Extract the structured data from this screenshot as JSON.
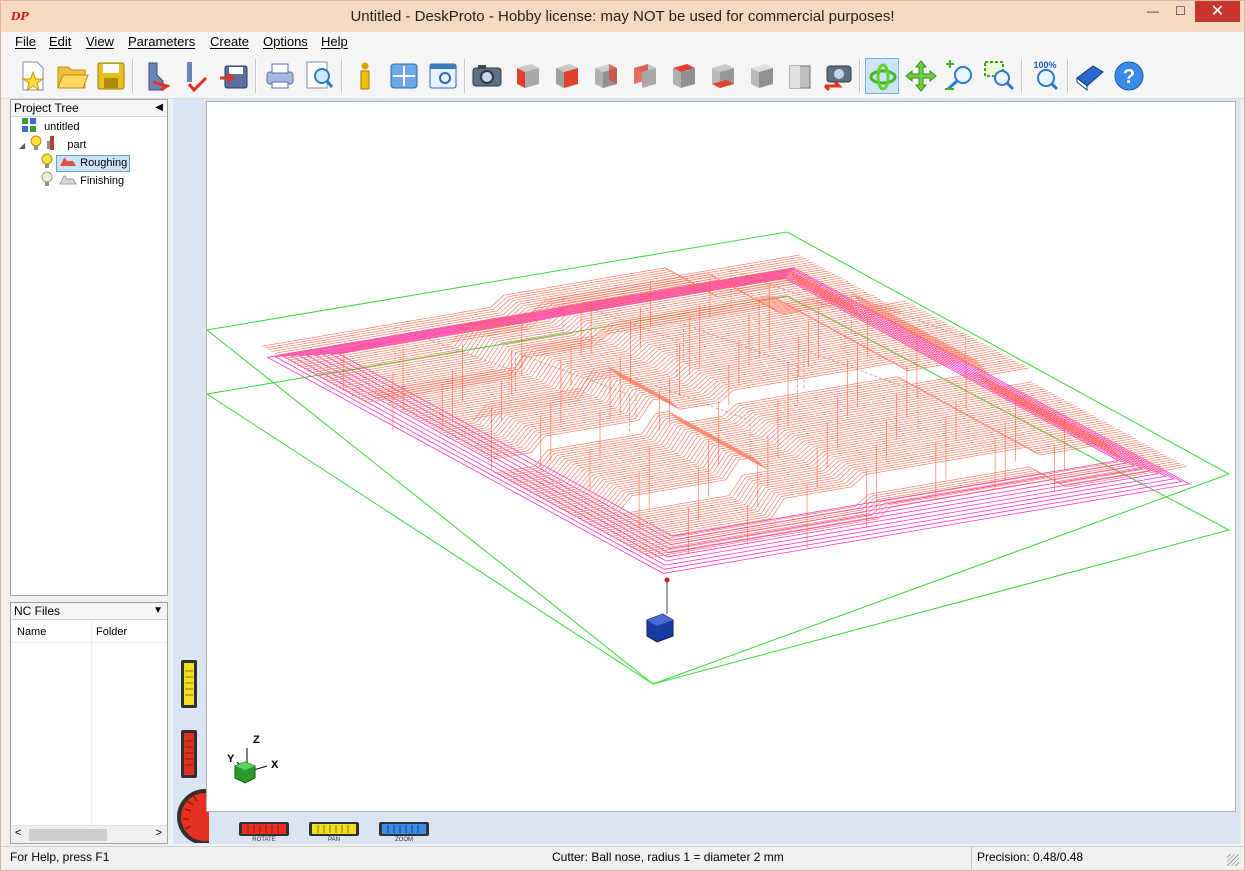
{
  "window": {
    "logo": "DP",
    "title": "Untitled - DeskProto - Hobby license: may NOT be used for commercial purposes!",
    "minimize": "—",
    "maximize": "☐",
    "close": "✕"
  },
  "menu": [
    "File",
    "Edit",
    "View",
    "Parameters",
    "Create",
    "Options",
    "Help"
  ],
  "toolbar": {
    "icons": [
      "new-project",
      "open-project",
      "save-project",
      "load-part",
      "load-vector",
      "save-as",
      "print",
      "print-preview",
      "info",
      "layout",
      "preview",
      "snapshot",
      "view-front",
      "view-right",
      "view-back",
      "view-left",
      "view-top",
      "view-bottom",
      "view-iso",
      "view-reset",
      "camera-restore",
      "rotate-mode",
      "pan-mode",
      "zoom-mode",
      "zoom-window",
      "zoom-100",
      "manual",
      "help"
    ],
    "zoom100_label": "100%"
  },
  "project_tree": {
    "title": "Project Tree",
    "items": [
      {
        "label": "untitled",
        "level": 0,
        "icon": "project-icon"
      },
      {
        "label": "part",
        "level": 1,
        "icon": "part-icon"
      },
      {
        "label": "Roughing",
        "level": 2,
        "icon": "operation-icon",
        "selected": true
      },
      {
        "label": "Finishing",
        "level": 2,
        "icon": "operation-icon",
        "selected": false
      }
    ]
  },
  "nc_files": {
    "title": "NC Files",
    "columns": [
      "Name",
      "Folder"
    ]
  },
  "viewport": {
    "axis": {
      "z": "Z",
      "y": "Y",
      "x": "X"
    },
    "dials": [
      "ROTATE",
      "PAN",
      "ZOOM"
    ],
    "toolpath_color": "#ff6a4d",
    "finishing_color": "#ff33cc",
    "block_color": "#33dd33"
  },
  "status": {
    "help": "For Help, press F1",
    "cutter": "Cutter: Ball nose, radius 1 = diameter 2 mm",
    "precision": "Precision: 0.48/0.48"
  }
}
